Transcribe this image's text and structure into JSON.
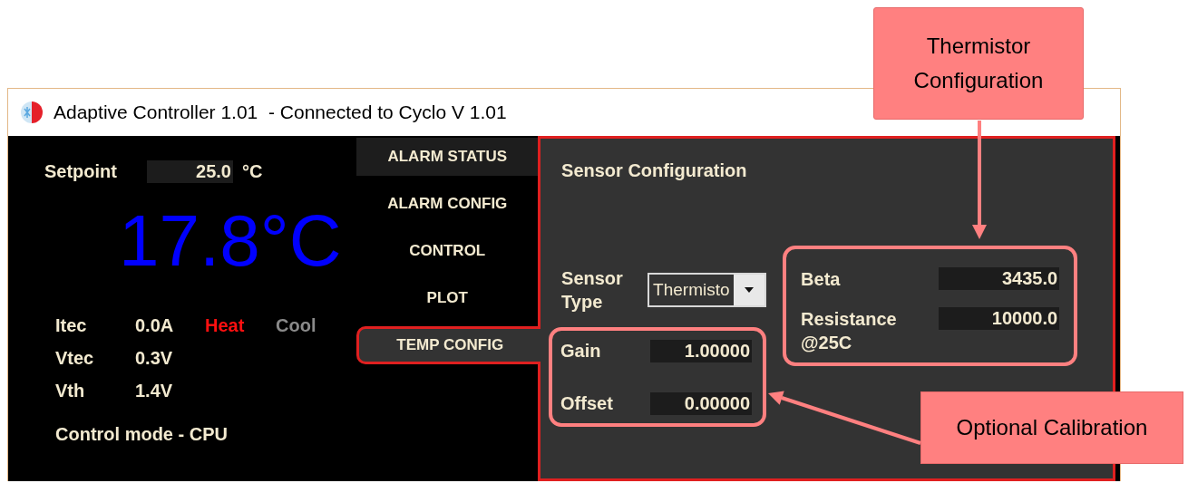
{
  "window": {
    "title": "Adaptive Controller 1.01  - Connected to Cyclo V 1.01"
  },
  "status": {
    "setpoint_label": "Setpoint",
    "setpoint_value": "25.0",
    "setpoint_unit": "°C",
    "temperature": "17.8°C",
    "readings": [
      {
        "label": "Itec",
        "value": "0.0A"
      },
      {
        "label": "Vtec",
        "value": "0.3V"
      },
      {
        "label": "Vth",
        "value": "1.4V"
      }
    ],
    "modes": [
      {
        "kind": "heat",
        "label": "Heat",
        "active": true
      },
      {
        "kind": "cool",
        "label": "Cool",
        "active": false
      }
    ],
    "control_mode": "Control mode - CPU"
  },
  "tabs": [
    {
      "label": "ALARM STATUS",
      "selected": false,
      "hovered": true
    },
    {
      "label": "ALARM CONFIG",
      "selected": false,
      "hovered": false
    },
    {
      "label": "CONTROL",
      "selected": false,
      "hovered": false
    },
    {
      "label": "PLOT",
      "selected": false,
      "hovered": false
    },
    {
      "label": "TEMP CONFIG",
      "selected": true,
      "hovered": false
    }
  ],
  "sensor_configuration": {
    "title": "Sensor Configuration",
    "sensor_type": {
      "label": "Sensor Type",
      "value": "Thermisto"
    },
    "calibration": [
      {
        "label": "Gain",
        "value": "1.00000"
      },
      {
        "label": "Offset",
        "value": "0.00000"
      }
    ],
    "thermistor": [
      {
        "label": "Beta",
        "value": "3435.0"
      },
      {
        "label": "Resistance @25C",
        "value": "10000.0"
      }
    ]
  },
  "annotations": [
    {
      "text": "Thermistor Configuration"
    },
    {
      "text": "Optional Calibration"
    }
  ]
}
